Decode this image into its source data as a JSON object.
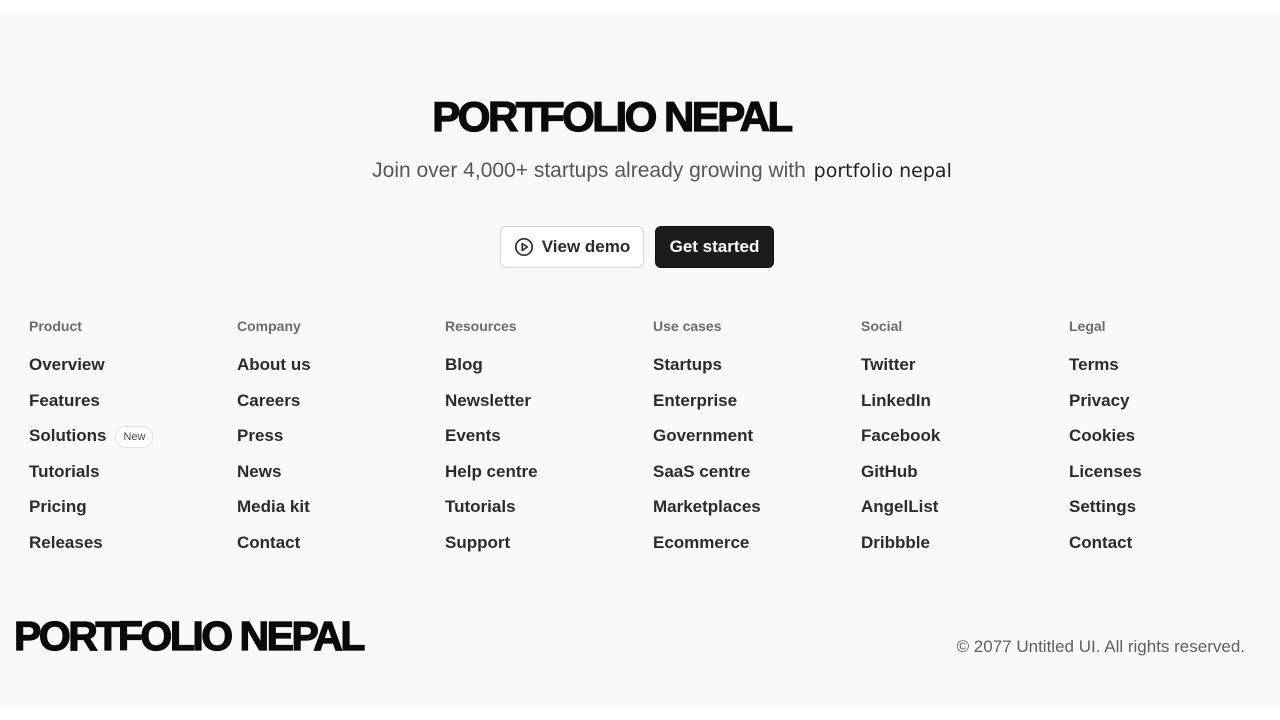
{
  "brand": {
    "logo_text": "PORTFOLIO NEPAL"
  },
  "hero": {
    "tagline_prefix": "Join over 4,000+ startups already growing with",
    "tagline_brand": "portfolio nepal",
    "demo_button_label": "View demo",
    "start_button_label": "Get started"
  },
  "columns": [
    {
      "heading": "Product",
      "items": [
        {
          "label": "Overview"
        },
        {
          "label": "Features"
        },
        {
          "label": "Solutions",
          "badge": "New"
        },
        {
          "label": "Tutorials"
        },
        {
          "label": "Pricing"
        },
        {
          "label": "Releases"
        }
      ]
    },
    {
      "heading": "Company",
      "items": [
        {
          "label": "About us"
        },
        {
          "label": "Careers"
        },
        {
          "label": "Press"
        },
        {
          "label": "News"
        },
        {
          "label": "Media kit"
        },
        {
          "label": "Contact"
        }
      ]
    },
    {
      "heading": "Resources",
      "items": [
        {
          "label": "Blog"
        },
        {
          "label": "Newsletter"
        },
        {
          "label": "Events"
        },
        {
          "label": "Help centre"
        },
        {
          "label": "Tutorials"
        },
        {
          "label": "Support"
        }
      ]
    },
    {
      "heading": "Use cases",
      "items": [
        {
          "label": "Startups"
        },
        {
          "label": "Enterprise"
        },
        {
          "label": "Government"
        },
        {
          "label": "SaaS centre"
        },
        {
          "label": "Marketplaces"
        },
        {
          "label": "Ecommerce"
        }
      ]
    },
    {
      "heading": "Social",
      "items": [
        {
          "label": "Twitter"
        },
        {
          "label": "LinkedIn"
        },
        {
          "label": "Facebook"
        },
        {
          "label": "GitHub"
        },
        {
          "label": "AngelList"
        },
        {
          "label": "Dribbble"
        }
      ]
    },
    {
      "heading": "Legal",
      "items": [
        {
          "label": "Terms"
        },
        {
          "label": "Privacy"
        },
        {
          "label": "Cookies"
        },
        {
          "label": "Licenses"
        },
        {
          "label": "Settings"
        },
        {
          "label": "Contact"
        }
      ]
    }
  ],
  "bottom": {
    "copyright": "© 2077 Untitled UI. All rights reserved."
  },
  "icons": {
    "demo_button_icon": "play-circle-icon"
  },
  "colors": {
    "background": "#f9f9f9",
    "primary_button": "#1c1c1c",
    "text_primary": "#2a2b2e",
    "text_muted": "#6b6c70"
  }
}
